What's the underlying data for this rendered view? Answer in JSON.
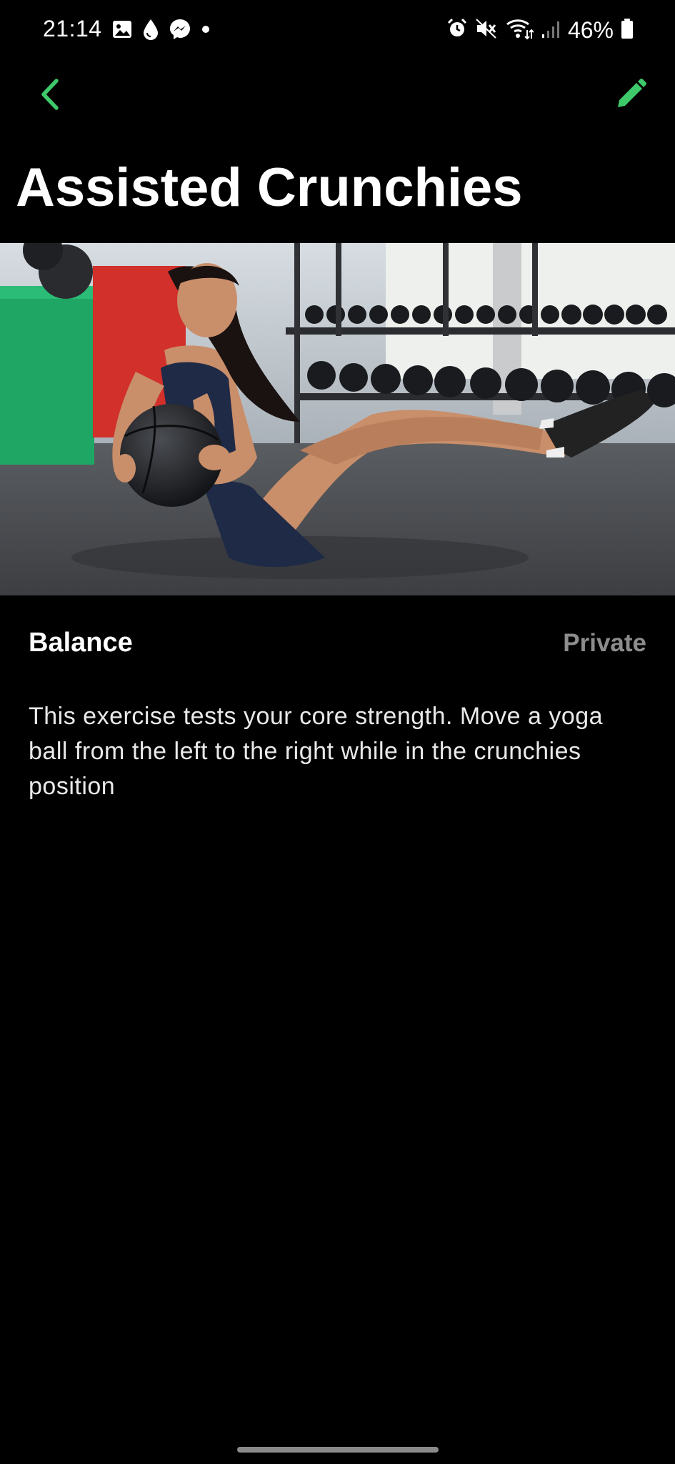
{
  "status_bar": {
    "time": "21:14",
    "battery": "46%",
    "left_icons": [
      "gallery-icon",
      "water-drop-icon",
      "messenger-icon",
      "dot-icon"
    ],
    "right_icons": [
      "alarm-icon",
      "mute-icon",
      "wifi-icon",
      "signal-icon",
      "battery-icon"
    ]
  },
  "nav": {
    "back_icon": "chevron-left-icon",
    "edit_icon": "pencil-icon",
    "accent_color": "#3ec96b"
  },
  "exercise": {
    "title": "Assisted Crunchies",
    "category": "Balance",
    "visibility": "Private",
    "description": "This exercise tests your core strength. Move a yoga ball from the left to the right while in the crunchies position"
  },
  "image": {
    "subject": "woman doing seated crunch with medicine ball in gym"
  }
}
